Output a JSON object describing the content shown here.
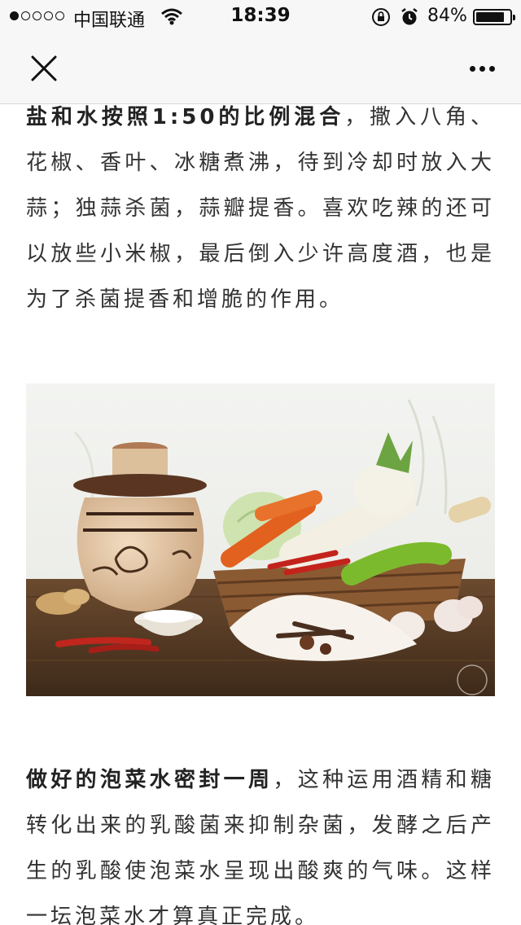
{
  "status_bar": {
    "carrier": "中国联通",
    "time": "18:39",
    "battery": "84%",
    "battery_level": 0.84
  },
  "nav": {
    "close_icon": "close-icon",
    "more_icon": "more-icon"
  },
  "article": {
    "para1_bold": "盐和水按照1:50的比例混合",
    "para1_text": "，撒入八角、花椒、香叶、冰糖煮沸，待到冷却时放入大蒜；独蒜杀菌，蒜瓣提香。喜欢吃辣的还可以放些小米椒，最后倒入少许高度酒，也是为了杀菌提香和增脆的作用。",
    "para2_bold": "做好的泡菜水密封一周",
    "para2_text": "，这种运用酒精和糖转化出来的乳酸菌来抑制杂菌，发酵之后产生的乳酸使泡菜水呈现出酸爽的气味。这样一坛泡菜水才算真正完成。"
  },
  "colors": {
    "bar_bg": "#f7f7f7",
    "text": "#333333"
  }
}
